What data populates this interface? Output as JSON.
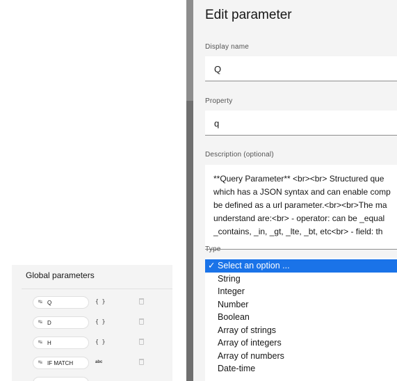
{
  "global_parameters": {
    "title": "Global parameters",
    "rows": [
      {
        "name": "Q",
        "type": "{ }"
      },
      {
        "name": "D",
        "type": "{ }"
      },
      {
        "name": "H",
        "type": "{ }"
      },
      {
        "name": "IF MATCH",
        "type": "abc"
      }
    ]
  },
  "modal": {
    "title": "Edit parameter",
    "display_name_label": "Display name",
    "display_name_value": "Q",
    "property_label": "Property",
    "property_value": "q",
    "description_label": "Description (optional)",
    "description_lines": [
      "**Query Parameter** <br><br> Structured que",
      "which has a JSON syntax and can enable comp",
      "be defined as a url parameter.<br><br>The ma",
      "understand are:<br> - operator: can be _equal",
      "_contains, _in, _gt, _lte, _bt, etc<br> - field: th"
    ],
    "type_label": "Type",
    "type_options": [
      "Select an option ...",
      "String",
      "Integer",
      "Number",
      "Boolean",
      "Array of strings",
      "Array of integers",
      "Array of numbers",
      "Date-time"
    ],
    "check_mark": "✓",
    "accent_color": "#1a73e8"
  }
}
